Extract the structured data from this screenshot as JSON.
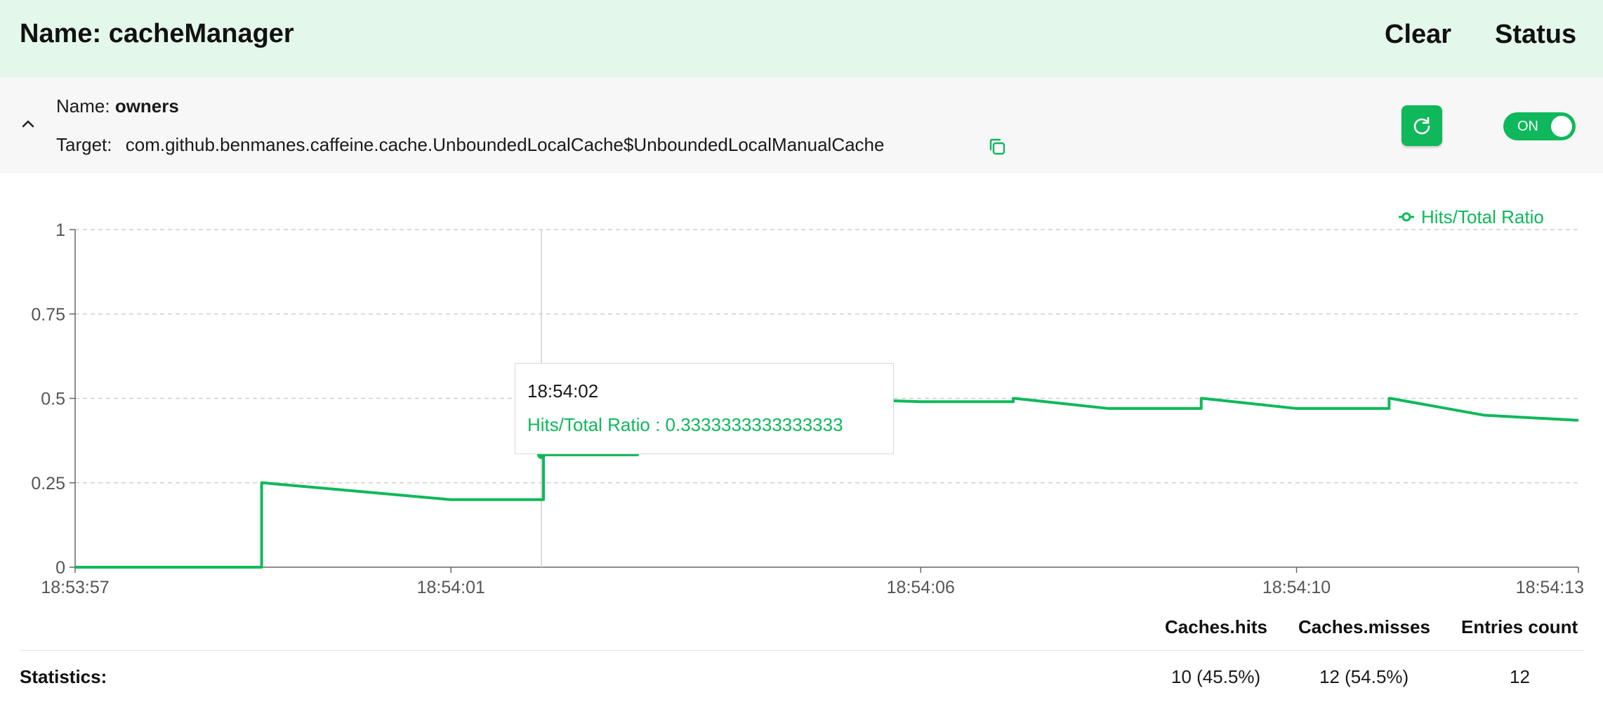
{
  "header": {
    "title": "Name: cacheManager",
    "clear_label": "Clear",
    "status_label": "Status"
  },
  "cache": {
    "name_prefix": "Name:",
    "name": "owners",
    "target_prefix": "Target:",
    "target": "com.github.benmanes.caffeine.cache.UnboundedLocalCache$UnboundedLocalManualCache",
    "status": "ON"
  },
  "icons": {
    "expand": "chevron-up-icon",
    "copy": "copy-icon",
    "refresh": "refresh-icon"
  },
  "colors": {
    "accent": "#0fb85b",
    "header_bg": "#e3f7ea",
    "row_bg": "#f7f7f7"
  },
  "chart_data": {
    "type": "line",
    "title": "",
    "xlabel": "",
    "ylabel": "",
    "ylim": [
      0,
      1
    ],
    "y_ticks": [
      "0",
      "0.25",
      "0.5",
      "0.75",
      "1"
    ],
    "x_ticks": [
      "18:53:57",
      "18:54:01",
      "18:54:06",
      "18:54:10",
      "18:54:13"
    ],
    "grid": true,
    "legend_position": "top-right",
    "series": [
      {
        "name": "Hits/Total Ratio",
        "x": [
          "18:53:57",
          "18:53:58",
          "18:53:59",
          "18:54:00",
          "18:54:01",
          "18:54:02",
          "18:54:03",
          "18:54:04",
          "18:54:05",
          "18:54:06",
          "18:54:07",
          "18:54:08",
          "18:54:09",
          "18:54:10",
          "18:54:11",
          "18:54:12",
          "18:54:13"
        ],
        "values": [
          0,
          0,
          0.25,
          0.225,
          0.2,
          0.333,
          0.4,
          0.45,
          0.5,
          0.49,
          0.5,
          0.47,
          0.5,
          0.47,
          0.5,
          0.45,
          0.435
        ]
      }
    ],
    "tooltip": {
      "time": "18:54:02",
      "text": "Hits/Total Ratio : 0.3333333333333333"
    }
  },
  "statistics": {
    "label": "Statistics:",
    "columns": [
      "Caches.hits",
      "Caches.misses",
      "Entries count"
    ],
    "values": [
      "10 (45.5%)",
      "12 (54.5%)",
      "12"
    ]
  }
}
